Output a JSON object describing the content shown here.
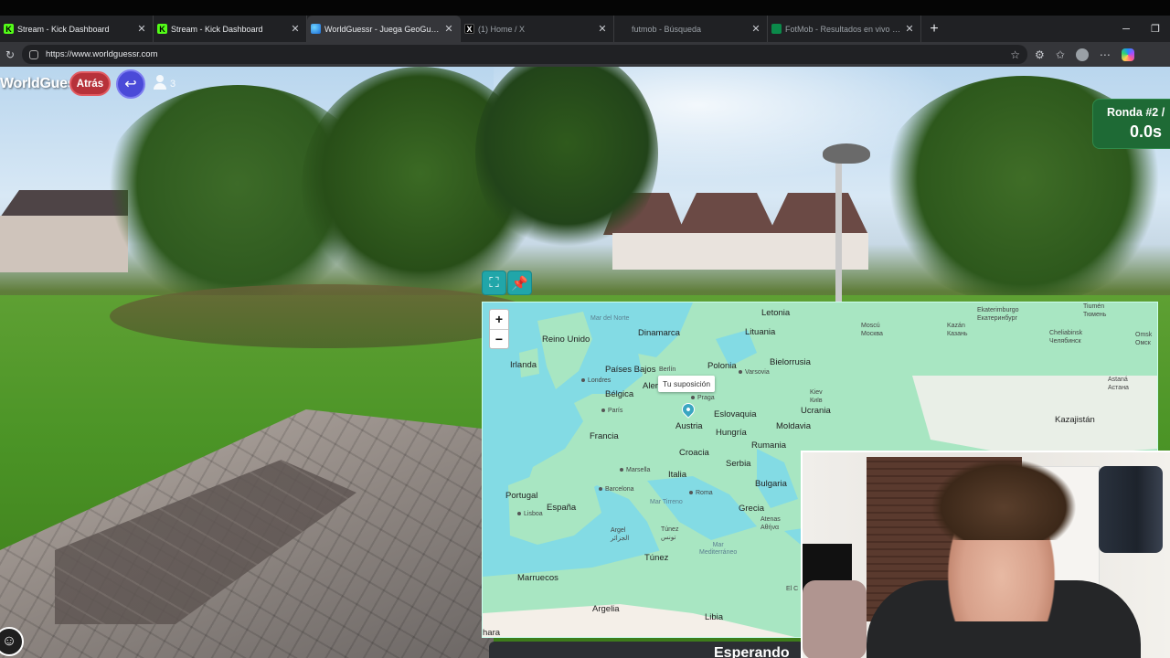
{
  "browser": {
    "tabs": [
      {
        "title": "Stream - Kick Dashboard",
        "favicon": "kick-icon",
        "active": false
      },
      {
        "title": "Stream - Kick Dashboard",
        "favicon": "kick-icon",
        "active": false
      },
      {
        "title": "WorldGuessr - Juega GeoGuessr gratis",
        "favicon": "globe-icon",
        "active": true
      },
      {
        "title": "(1) Home / X",
        "favicon": "x-icon",
        "active": false
      },
      {
        "title": "futmob - Búsqueda",
        "favicon": "search-icon",
        "active": false
      },
      {
        "title": "FotMob - Resultados en vivo de fútbol",
        "favicon": "fotmob-icon",
        "active": false
      }
    ],
    "new_tab": "+",
    "url": "https://www.worldguessr.com",
    "window_controls": {
      "minimize": "─",
      "maximize": "❐"
    }
  },
  "game": {
    "logo_text": "WorldGuessr",
    "back_label": "Atrás",
    "return_icon": "↩",
    "player_count": "3",
    "round_label": "Ronda #2 /",
    "timer": "0.0s",
    "waiting_text": "Esperando",
    "emoji_icon": "☺"
  },
  "map": {
    "zoom_in": "+",
    "zoom_out": "−",
    "tooltip": "Tu suposición",
    "labels": {
      "mar_norte": "Mar del Norte",
      "dinamarca": "Dinamarca",
      "letonia": "Letonia",
      "lituania": "Lituania",
      "reino_unido": "Reino Unido",
      "irlanda": "Irlanda",
      "paises_bajos": "Países Bajos",
      "berlin": "Berlín",
      "polonia": "Polonia",
      "bielorrusia": "Bielorrusia",
      "londres": "Londres",
      "varsovia": "Varsovia",
      "belgica": "Bélgica",
      "alemania": "Aler",
      "praga": "Praga",
      "kiev": "Kiev\nКиїв",
      "paris": "París",
      "ucrania": "Ucrania",
      "austria": "Austria",
      "eslovaquia": "Eslovaquia",
      "moldavia": "Moldavia",
      "francia": "Francia",
      "hungria": "Hungría",
      "croacia": "Croacia",
      "rumania": "Rumania",
      "marsella": "Marsella",
      "italia": "Italia",
      "serbia": "Serbia",
      "bulgaria": "Bulgaria",
      "portugal": "Portugal",
      "barcelona": "Barcelona",
      "espana": "España",
      "roma": "Roma",
      "mar_tirreno": "Mar Tirreno",
      "grecia": "Grecia",
      "lisboa": "Lisboa",
      "atenas": "Atenas\nΑθήνα",
      "argel": "Argel\nالجزائر",
      "tunez_city": "Túnez\nتونس",
      "mar_mediterraneo": "Mar\nMediterráneo",
      "tunez": "Túnez",
      "marruecos": "Marruecos",
      "argelia": "Argelia",
      "libia": "Libia",
      "sahara": "hara",
      "el_c": "El C",
      "moscu": "Moscú\nМосква",
      "kazan": "Kazán\nКазань",
      "ekaterinburgo": "Ekaterimburgo\nЕкатеринбург",
      "tiumen": "Tiumén\nТюмень",
      "chelyabinsk": "Cheliabinsk\nЧелябинск",
      "omsk": "Omsk\nОмск",
      "astana": "Astaná\nАстана",
      "kazajistan": "Kazajistán"
    }
  },
  "colors": {
    "accent_teal": "#21a6a9",
    "back_red": "#b7323a",
    "return_blue": "#4a4ad8",
    "round_green": "#1e6a35",
    "sea": "#83dbe4",
    "land": "#a8e6c2"
  }
}
